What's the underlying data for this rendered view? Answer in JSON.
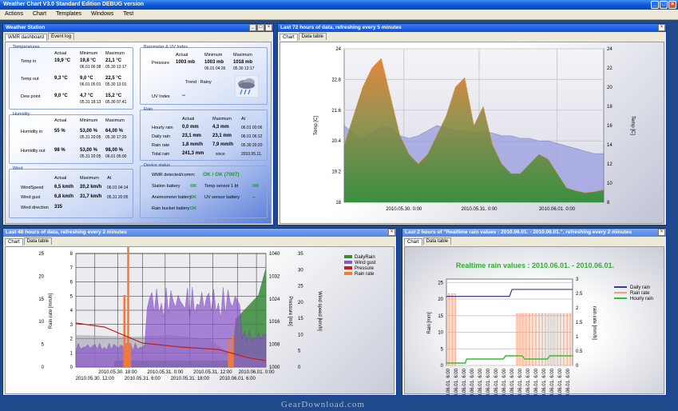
{
  "app": {
    "title": "Weather Chart V3.0 Standard Edition DEBUG version"
  },
  "menu": [
    "Actions",
    "Chart",
    "Templates",
    "Windows",
    "Test"
  ],
  "station": {
    "title": "Weather Station",
    "tabs": [
      "WMR dashboard",
      "Event log"
    ],
    "temperatures": {
      "title": "Temperatures",
      "headers": [
        "Actual",
        "Minimum",
        "Maximum"
      ],
      "rows": [
        {
          "label": "Temp in",
          "actual": "19,9 °C",
          "min": "19,8 °C",
          "min_at": "06.01 06:38",
          "max": "21,1 °C",
          "max_at": "05.30 13:17"
        },
        {
          "label": "Temp out",
          "actual": "9,3 °C",
          "min": "9,0 °C",
          "min_at": "06.01 05:01",
          "max": "22,5 °C",
          "max_at": "05.30 13:01"
        },
        {
          "label": "Dew point",
          "actual": "9,0 °C",
          "min": "4,7 °C",
          "min_at": "05.31 18:13",
          "max": "15,2 °C",
          "max_at": "05.30 07:41"
        }
      ]
    },
    "humidity": {
      "title": "Humidity",
      "headers": [
        "Actual",
        "Minimum",
        "Maximum"
      ],
      "rows": [
        {
          "label": "Humidity in",
          "actual": "55 %",
          "min": "53,00 %",
          "min_at": "05.31 20:05",
          "max": "64,00 %",
          "max_at": "05.30 17:20"
        },
        {
          "label": "Humidity out",
          "actual": "98 %",
          "min": "53,00 %",
          "min_at": "05.31 20:05",
          "max": "98,00 %",
          "max_at": "06.01 05:00"
        }
      ]
    },
    "wind": {
      "title": "Wind",
      "headers": [
        "Actual",
        "Maximum",
        "At"
      ],
      "rows": [
        {
          "label": "WindSpeed",
          "actual": "6,5 km/h",
          "max": "20,2 km/h",
          "at": "06.01 04:14"
        },
        {
          "label": "Wind gust",
          "actual": "6,8 km/h",
          "max": "31,7 km/h",
          "at": "05.31 20:05"
        },
        {
          "label": "Wind direction",
          "actual": "335",
          "max": "",
          "at": ""
        }
      ]
    },
    "barometer": {
      "title": "Barometer & UV Index",
      "headers": [
        "Actual",
        "Minimum",
        "Maximum"
      ],
      "pressure_label": "Pressure",
      "actual": "1003 mb",
      "min": "1003 mb",
      "min_at": "06.01 04:26",
      "max": "1018 mb",
      "max_at": "05.30 13:17",
      "trend": "Trend : Rainy",
      "uv_label": "UV Index",
      "uv_value": "--"
    },
    "rain": {
      "title": "Rain",
      "headers": [
        "Actual",
        "Maximum",
        "At"
      ],
      "rows": [
        {
          "label": "Hourly rain",
          "actual": "0,0 mm",
          "max": "4,3 mm",
          "at": "06.01 00:06"
        },
        {
          "label": "Daily rain",
          "actual": "23,1 mm",
          "max": "23,1 mm",
          "at": "06.01 06:12"
        },
        {
          "label": "Rain rate",
          "actual": "1,8 mm/h",
          "max": "7,9 mm/h",
          "at": "05.30 20:20"
        },
        {
          "label": "Total rain",
          "actual": "241,3 mm",
          "max": "since",
          "at": "2010.05.11."
        }
      ]
    },
    "device": {
      "title": "Device status",
      "wmr_label": "WMR detected/comm:",
      "wmr_value": "OK / OK (7007)",
      "rows": [
        {
          "label": "Station battery",
          "value": "OK",
          "label2": "Temp sensor 1 bt",
          "value2": "OK"
        },
        {
          "label": "Anemometer battery",
          "value": "OK",
          "label2": "UV sensor battery",
          "value2": "--"
        },
        {
          "label": "Rain bucket battery",
          "value": "OK",
          "label2": "",
          "value2": ""
        }
      ]
    }
  },
  "chart72": {
    "title": "Last 72 hours of data, refreshing every 5 minutes",
    "tabs": [
      "Chart",
      "Data table"
    ]
  },
  "chart48": {
    "title": "Last 48 hours of data, refreshing every 3 minutes",
    "tabs": [
      "Chart",
      "Data table"
    ]
  },
  "chart2": {
    "title": "Last 2 hours of \"Realtime rain values : 2010.06.01. - 2010.06.01.\", refreshing every 2 minutes",
    "tabs": [
      "Chart",
      "Data table"
    ]
  },
  "chart_data": [
    {
      "type": "area",
      "name": "72h",
      "ylabel": "Temp [C]",
      "y2label": "Temp [C]",
      "yticks": [
        18,
        19.2,
        20.4,
        21.6,
        22.8,
        24
      ],
      "y2ticks": [
        8,
        10,
        12,
        14,
        16,
        18,
        20,
        22,
        24
      ],
      "xticks": [
        "2010.05.30. 0:00",
        "2010.05.31. 0:00",
        "2010.06.01. 0:00"
      ],
      "ylim": [
        18,
        24
      ],
      "y2lim": [
        8,
        24
      ],
      "series": [
        {
          "name": "Temp in",
          "axis": "left",
          "color": "#8c8fd8",
          "values": [
            21.0,
            20.7,
            20.5,
            20.7,
            21.0,
            20.9,
            20.6,
            20.5,
            20.6,
            20.8,
            21.0,
            20.9,
            20.8,
            20.8,
            20.7,
            20.8,
            20.7,
            20.6,
            20.6,
            20.5,
            20.5,
            20.4,
            20.4,
            20.3,
            20.2,
            20.1,
            20.0,
            19.9,
            19.9
          ]
        },
        {
          "name": "Temp out",
          "axis": "right",
          "color": "#3e8a3e",
          "values": [
            14,
            17,
            20,
            22,
            23,
            19,
            15,
            13,
            12,
            13,
            15,
            17,
            20,
            21,
            16,
            18,
            14,
            12,
            11,
            11,
            12,
            13,
            12.5,
            11,
            9.5,
            9.2,
            9.0,
            9.1,
            9.3
          ]
        }
      ]
    },
    {
      "type": "line",
      "name": "48h",
      "ylabel": "Rain rate [mm/h]",
      "y3label": "Pressure [mb]",
      "y4label": "Wind speed [km/h]",
      "yticks": [
        0,
        5,
        10,
        15,
        20,
        25
      ],
      "y2ticks": [
        0,
        1,
        2,
        3,
        4,
        5,
        6,
        7,
        8
      ],
      "y3ticks": [
        1000,
        1008,
        1016,
        1024,
        1032,
        1040
      ],
      "y4ticks": [
        0,
        5,
        10,
        15,
        20,
        25,
        30,
        35
      ],
      "xticks": [
        "2010.05.30. 18:00",
        "2010.05.31. 0:00",
        "2010.05.31. 12:00",
        "2010.06.01. 0:00"
      ],
      "xticks2": [
        "2010.05.30. 12:00",
        "2010.05.31. 6:00",
        "2010.05.31. 18:00",
        "2010.06.01. 6:00"
      ],
      "legend": [
        "DailyRain",
        "Wind gust",
        "Pressure",
        "Rain rate"
      ],
      "legend_colors": [
        "#3a8a3a",
        "#8b55c8",
        "#c0201c",
        "#f07a3a"
      ]
    },
    {
      "type": "line",
      "name": "2h",
      "title": "Realtime rain values : 2010.06.01. - 2010.06.01.",
      "ylabel": "Rain [mm]",
      "y2label": "rain rate [mm/h]",
      "yticks": [
        0,
        5,
        10,
        15,
        20,
        25
      ],
      "y2ticks": [
        0,
        0.5,
        1,
        1.5,
        2,
        2.5,
        3
      ],
      "legend": [
        "Daily rain",
        "Rain rate",
        "Hourly rain"
      ],
      "legend_colors": [
        "#3a3a8a",
        "#f0a080",
        "#30c030"
      ],
      "xtick_label": "2010.06.01. 6:00"
    }
  ]
}
